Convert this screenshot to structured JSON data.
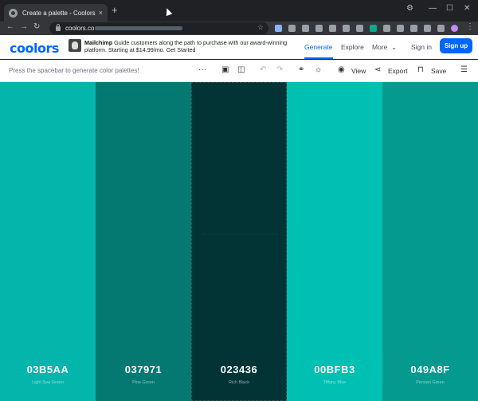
{
  "browser": {
    "tab_title": "Create a palette - Coolors",
    "tab_close": "×",
    "new_tab": "+",
    "url": "coolors.co",
    "window": {
      "minimize": "—",
      "maximize": "☐",
      "close": "✕"
    }
  },
  "header": {
    "logo": "coolors",
    "ad": {
      "brand": "Mailchimp",
      "text": "Guide customers along the path to purchase with our award-winning platform. Starting at $14.99/mo.",
      "cta": "Get Started"
    },
    "menu": {
      "generate": "Generate",
      "explore": "Explore",
      "more": "More"
    },
    "signin": "Sign in",
    "signup": "Sign up"
  },
  "subbar": {
    "hint": "Press the spacebar to generate color palettes!",
    "view": "View",
    "export": "Export",
    "save": "Save"
  },
  "palette": [
    {
      "hex": "03B5AA",
      "name": "Light Sea Green",
      "color": "#03B5AA"
    },
    {
      "hex": "037971",
      "name": "Pine Green",
      "color": "#037971"
    },
    {
      "hex": "023436",
      "name": "Rich Black",
      "color": "#023436"
    },
    {
      "hex": "00BFB3",
      "name": "Tiffany Blue",
      "color": "#00BFB3"
    },
    {
      "hex": "049A8F",
      "name": "Persian Green",
      "color": "#049A8F"
    }
  ],
  "colors": {
    "brand": "#0066ff"
  }
}
